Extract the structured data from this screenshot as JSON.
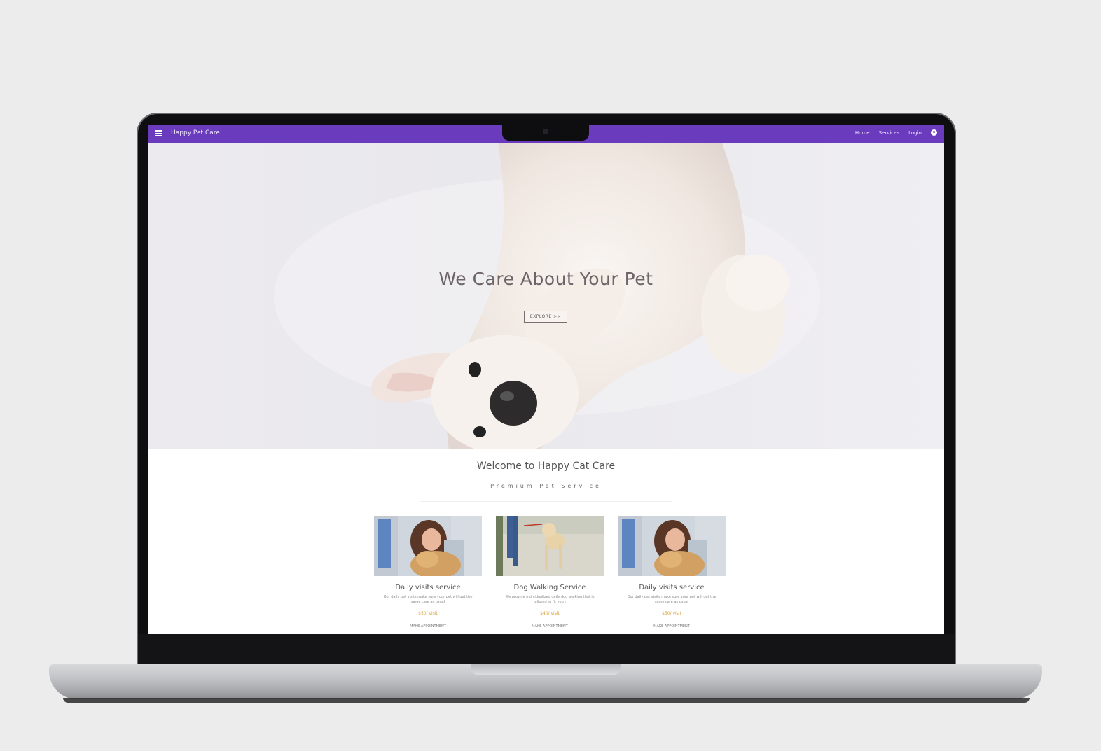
{
  "site": {
    "brand": "Happy Pet Care",
    "nav": [
      {
        "label": "Home"
      },
      {
        "label": "Services"
      },
      {
        "label": "Login"
      }
    ]
  },
  "hero": {
    "title": "We Care About Your Pet",
    "button_label": "EXPLORE >>"
  },
  "intro": {
    "title": "Welcome to Happy Cat Care",
    "subtitle": "Premium Pet Service"
  },
  "cards": [
    {
      "title": "Daily visits service",
      "description": "Our daily pet visits make sure your pet will get the same care as usual",
      "price": "$50/ visit",
      "link": "MAKE APPOINTMENT"
    },
    {
      "title": "Dog Walking Service",
      "description": "We provide individualized daily dog walking that is tailored to fit you r",
      "price": "$40/ visit",
      "link": "MAKE APPOINTMENT"
    },
    {
      "title": "Daily visits service",
      "description": "Our daily pet visits make sure your pet will get the same care as usual",
      "price": "$50/ visit",
      "link": "MAKE APPOINTMENT"
    }
  ],
  "colors": {
    "topbar": "#6a3bbd",
    "price": "#d7a33a",
    "background": "#ececec"
  },
  "icons": {
    "menu": "hamburger-icon",
    "account": "account-circle-icon"
  }
}
